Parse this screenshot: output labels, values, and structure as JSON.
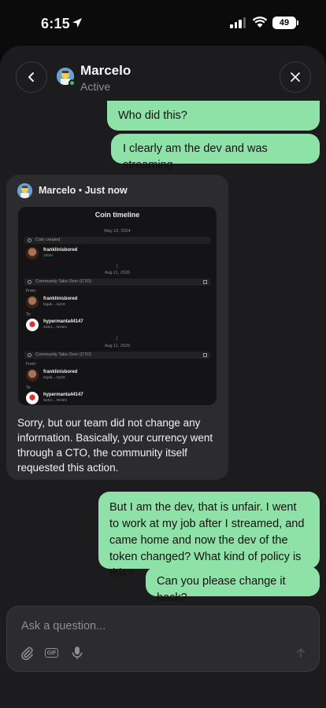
{
  "status_bar": {
    "time": "6:15",
    "battery": "49"
  },
  "header": {
    "name": "Marcelo",
    "status": "Active"
  },
  "messages": {
    "user_1": "Who did this?",
    "user_2": "I clearly am the dev and was streaming",
    "agent": {
      "name": "Marcelo",
      "separator": "•",
      "time": "Just now",
      "text": "Sorry, but our team did not change any information. Basically, your currency went through a CTO, the community itself requested this action."
    },
    "user_3": "But I am the dev, that is unfair. I went to work at my job after I streamed, and came home and now the dev of the token changed? What kind of policy is this?",
    "user_4": "Can you please change it back?"
  },
  "screenshot": {
    "title": "Coin timeline",
    "date_1": "May 13, 2024",
    "coin_created": "Coin created",
    "creator_name": "franklinisbored",
    "creator_pct": "100%",
    "date_2": "Aug 11, 2026",
    "cto_label": "Community Take Over (CTO)",
    "from_label": "From:",
    "to_label": "To:",
    "from_name": "franklinisbored",
    "from_addr": "Dgak....zqC8",
    "to_name": "hypermanta44147",
    "to_addr": "SeKz....NV6m",
    "date_3": "Aug 11, 2026",
    "cto_label_2": "Community Take Over (CTO)",
    "from_name_2": "franklinisbored",
    "from_addr_2": "Dgak....zqC8",
    "to_name_2": "hypermanta44147",
    "to_addr_2": "SeKz....NV6m"
  },
  "composer": {
    "placeholder": "Ask a question..."
  },
  "icons": [
    "location-arrow-icon",
    "signal-icon",
    "wifi-icon",
    "battery-icon",
    "back-chevron-icon",
    "close-icon",
    "paperclip-icon",
    "gif-icon",
    "microphone-icon",
    "send-arrow-icon"
  ],
  "colors": {
    "user_bubble": "#8ee2a8",
    "sheet": "#1c1c1e",
    "card": "#2c2c2e",
    "online": "#34c759"
  }
}
